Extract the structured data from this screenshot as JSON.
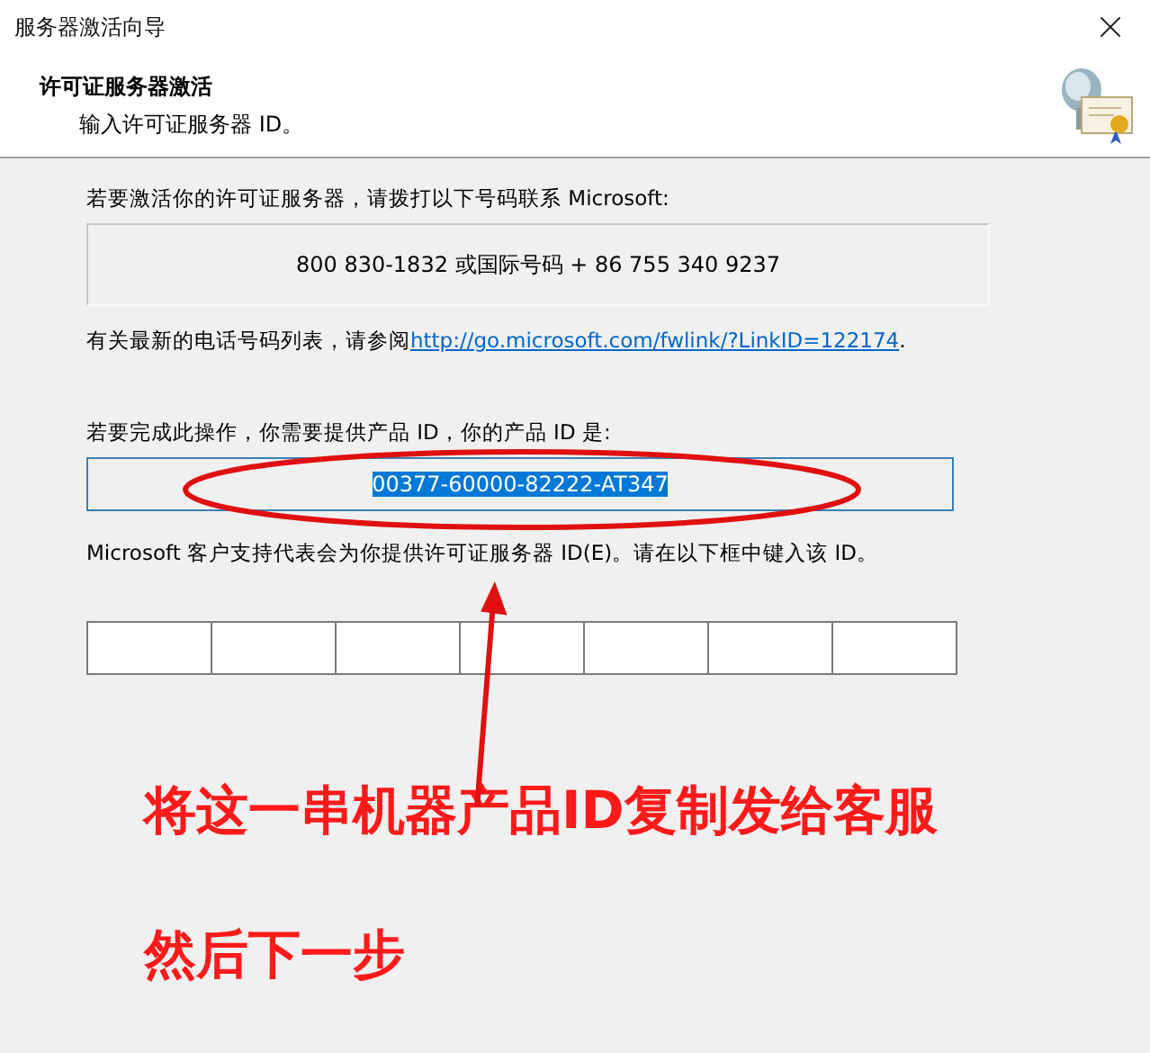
{
  "window": {
    "title": "服务器激活向导"
  },
  "header": {
    "title": "许可证服务器激活",
    "subtitle": "输入许可证服务器 ID。"
  },
  "call_instruction": "若要激活你的许可证服务器，请拨打以下号码联系 Microsoft:",
  "phone_numbers": "800 830-1832 或国际号码 + 86 755 340 9237",
  "phone_list": {
    "prefix": "有关最新的电话号码列表，请参阅",
    "link": "http://go.microsoft.com/fwlink/?LinkID=122174",
    "suffix": "."
  },
  "product_id_label": "若要完成此操作，你需要提供产品 ID，你的产品 ID 是:",
  "product_id": {
    "value": "00377-60000-82222-AT347",
    "selected": true
  },
  "support_text": "Microsoft 客户支持代表会为你提供许可证服务器 ID(E)。请在以下框中键入该 ID。",
  "annotation": {
    "lines": [
      "将这一串机器产品ID复制发给客服",
      "然后下一步"
    ]
  }
}
